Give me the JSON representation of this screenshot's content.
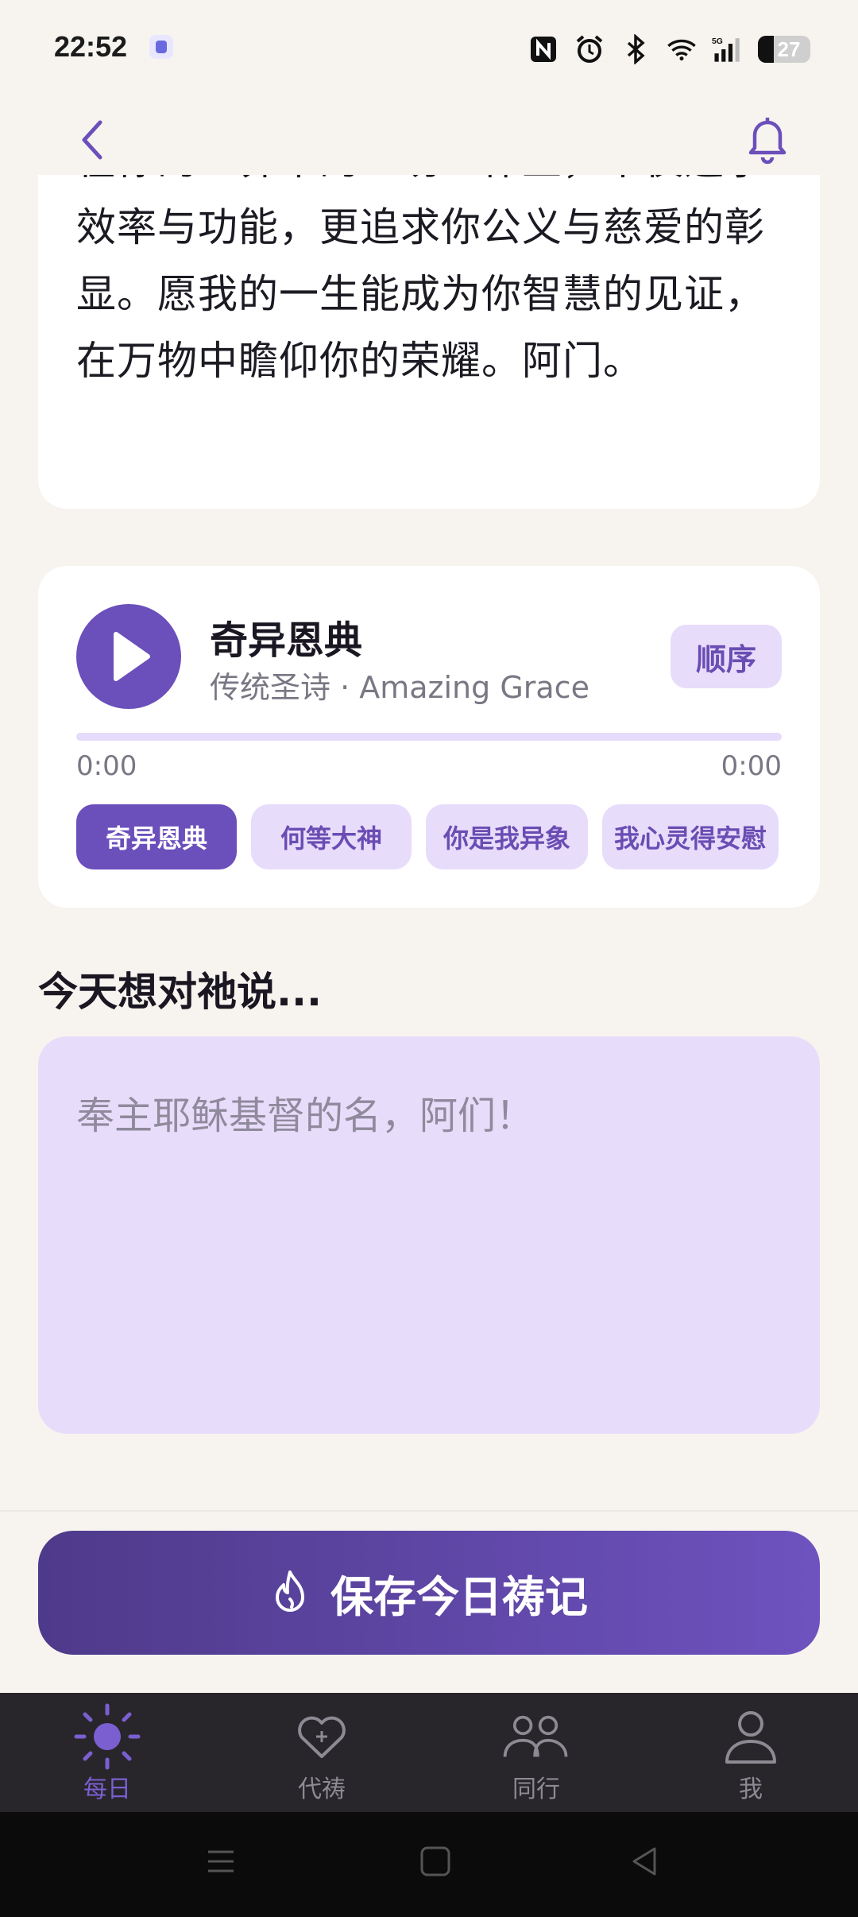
{
  "status_bar": {
    "time": "22:52",
    "battery": "27"
  },
  "prayer": {
    "text": "在你的世界中的一切工作上，不仅追求效率与功能，更追求你公义与慈爱的彰显。愿我的一生能成为你智慧的见证，在万物中瞻仰你的荣耀。阿门。"
  },
  "player": {
    "title": "奇异恩典",
    "subtitle": "传统圣诗 · Amazing Grace",
    "mode_label": "顺序",
    "current_time": "0:00",
    "duration": "0:00",
    "progress": 0,
    "tracks": [
      "奇异恩典",
      "何等大神",
      "你是我异象",
      "我心灵得安慰"
    ],
    "active_track": 0
  },
  "journal": {
    "title": "今天想对祂说...",
    "placeholder": "奉主耶稣基督的名，阿们！"
  },
  "save_button": {
    "label": "保存今日祷记"
  },
  "tabs": [
    {
      "label": "每日",
      "icon": "sun-icon",
      "active": true
    },
    {
      "label": "代祷",
      "icon": "heart-plus-icon",
      "active": false
    },
    {
      "label": "同行",
      "icon": "people-icon",
      "active": false
    },
    {
      "label": "我",
      "icon": "person-icon",
      "active": false
    }
  ],
  "colors": {
    "accent": "#6b4fbb",
    "chip_bg": "#e8dcfb",
    "page_bg": "#f7f4ef",
    "tab_bar": "#28262b"
  }
}
